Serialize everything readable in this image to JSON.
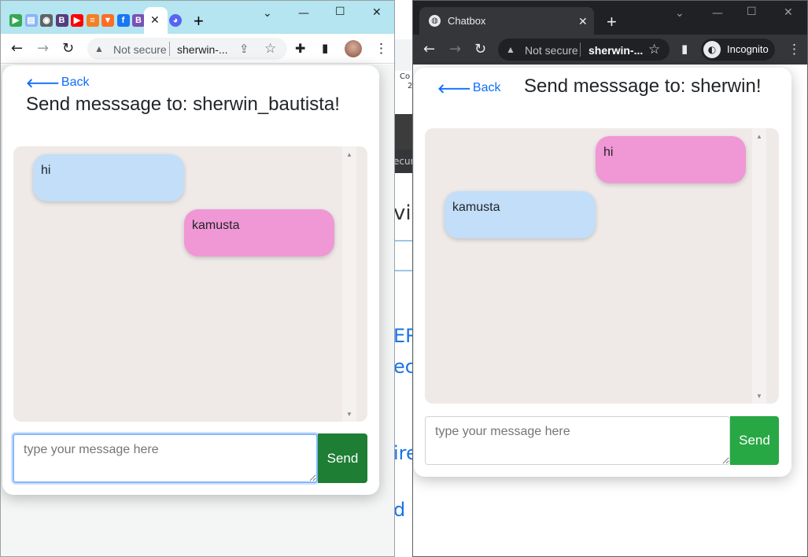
{
  "background_page": {
    "fragments": [
      "Co",
      "2",
      "ecur",
      "vir",
      "ER",
      "ec",
      "ire",
      "d"
    ]
  },
  "left_window": {
    "tab_icons": [
      {
        "name": "meet-icon",
        "glyph": "▶",
        "color": "#34a853"
      },
      {
        "name": "docs-icon",
        "glyph": "▤",
        "color": "#8ab4f8"
      },
      {
        "name": "cat-icon",
        "glyph": "◉",
        "color": "#5f6368"
      },
      {
        "name": "bootstrap-icon",
        "glyph": "B",
        "color": "#563d7c"
      },
      {
        "name": "youtube-icon",
        "glyph": "▶",
        "color": "#ff0000"
      },
      {
        "name": "stackoverflow-icon",
        "glyph": "≡",
        "color": "#f48024"
      },
      {
        "name": "gitlab-icon",
        "glyph": "▼",
        "color": "#fc6d26"
      },
      {
        "name": "facebook-icon",
        "glyph": "f",
        "color": "#1877f2"
      },
      {
        "name": "bootstrap-icon",
        "glyph": "B",
        "color": "#7952b3"
      }
    ],
    "active_tab_close": "✕",
    "extra_tab_icon": {
      "name": "discord-icon",
      "glyph": "◕",
      "color": "#5865f2"
    },
    "new_tab": "+",
    "window_controls": {
      "chevron": "⌄",
      "minimize": "—",
      "maximize": "☐",
      "close": "✕"
    },
    "toolbar": {
      "back": "←",
      "forward": "→",
      "reload": "↻",
      "warning": "▲",
      "not_secure": "Not secure",
      "url": "sherwin-...",
      "share": "⇪",
      "star": "☆",
      "extensions": "✚",
      "sidepanel": "▮",
      "menu": "⋮"
    },
    "chat": {
      "back_label": "Back",
      "title": "Send messsage to: sherwin_bautista!",
      "messages": [
        {
          "text": "hi",
          "side": "left"
        },
        {
          "text": "kamusta",
          "side": "right"
        }
      ],
      "input_placeholder": "type your message here",
      "send_label": "Send"
    }
  },
  "right_window": {
    "tab_title": "Chatbox",
    "tab_close": "✕",
    "new_tab": "+",
    "window_controls": {
      "chevron": "⌄",
      "minimize": "—",
      "maximize": "☐",
      "close": "✕"
    },
    "toolbar": {
      "back": "←",
      "forward": "→",
      "reload": "↻",
      "warning": "▲",
      "not_secure": "Not secure",
      "url": "sherwin-...",
      "star": "☆",
      "sidepanel": "▮",
      "incognito_label": "Incognito",
      "menu": "⋮"
    },
    "chat": {
      "back_label": "Back",
      "title": "Send messsage to: sherwin!",
      "messages": [
        {
          "text": "hi",
          "side": "right"
        },
        {
          "text": "kamusta",
          "side": "left"
        }
      ],
      "input_placeholder": "type your message here",
      "send_label": "Send"
    }
  },
  "colors": {
    "left_tabstrip": "#b4e5f0",
    "dark_chrome": "#202124",
    "link_blue": "#0d6efd",
    "bubble_blue": "#c2def8",
    "bubble_pink": "#f097d5",
    "message_area": "#efeae8",
    "send_green": "#28a745"
  }
}
